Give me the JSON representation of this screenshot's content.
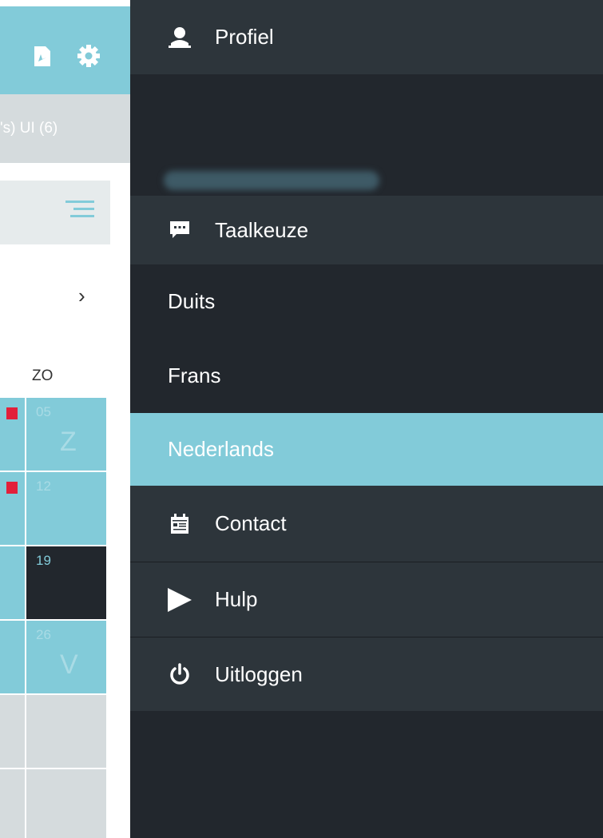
{
  "left_panel": {
    "filter_text": "'s) UI (6)",
    "next_arrow": "›",
    "day_header": "ZO",
    "calendar_days": [
      {
        "day": "05",
        "letter": "Z",
        "style": "cyan",
        "marker": true
      },
      {
        "day": "12",
        "letter": "",
        "style": "cyan",
        "marker": true
      },
      {
        "day": "19",
        "letter": "",
        "style": "dark",
        "marker": false
      },
      {
        "day": "26",
        "letter": "V",
        "style": "cyan",
        "marker": false
      },
      {
        "day": "",
        "letter": "",
        "style": "grey",
        "marker": false
      },
      {
        "day": "",
        "letter": "",
        "style": "grey",
        "marker": false
      }
    ]
  },
  "drawer": {
    "profile_label": "Profiel",
    "language_label": "Taalkeuze",
    "languages": [
      "Duits",
      "Frans",
      "Nederlands"
    ],
    "selected_language": "Nederlands",
    "contact_label": "Contact",
    "help_label": "Hulp",
    "logout_label": "Uitloggen"
  },
  "colors": {
    "accent": "#82cbd9",
    "drawer_bg": "#22272d",
    "section_bg": "#2d353b",
    "marker_red": "#e2203a"
  }
}
